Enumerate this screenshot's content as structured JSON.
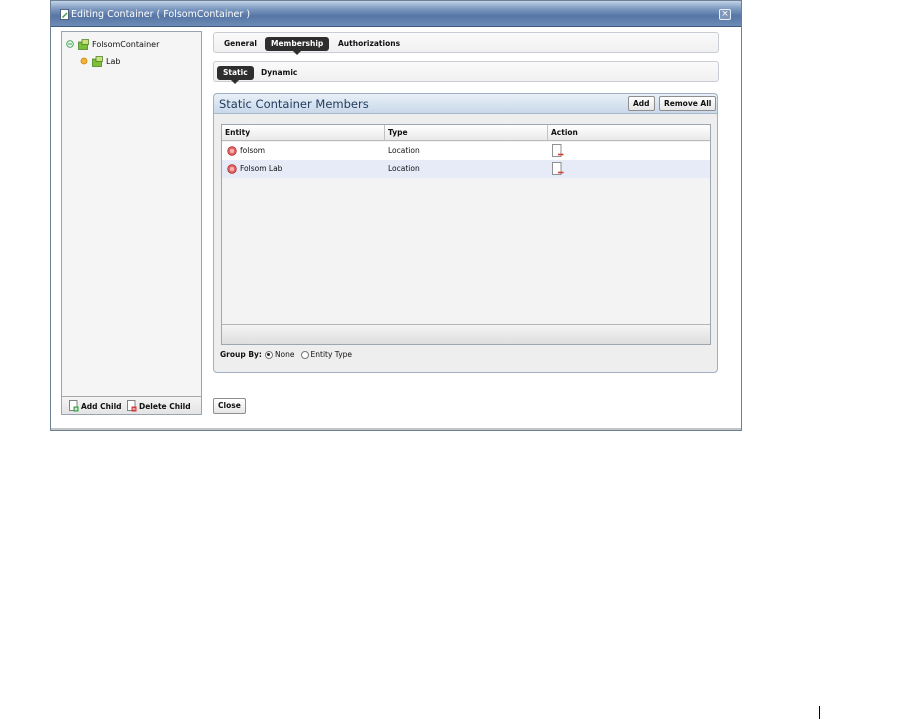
{
  "dialog": {
    "title": "Editing Container ( FolsomContainer )",
    "close_label": "×"
  },
  "tree": {
    "root": {
      "label": "FolsomContainer",
      "expanded": true,
      "toggle_icon": "minus-circle-icon",
      "icon": "container-icon"
    },
    "children": [
      {
        "label": "Lab",
        "toggle_icon": "leaf-dot-icon",
        "icon": "container-icon"
      }
    ],
    "footer": {
      "add_child_label": "Add Child",
      "delete_child_label": "Delete Child"
    }
  },
  "tabs": {
    "items": [
      {
        "label": "General",
        "active": false
      },
      {
        "label": "Membership",
        "active": true
      },
      {
        "label": "Authorizations",
        "active": false
      }
    ]
  },
  "subtabs": {
    "items": [
      {
        "label": "Static",
        "active": true
      },
      {
        "label": "Dynamic",
        "active": false
      }
    ]
  },
  "members_panel": {
    "title": "Static Container Members",
    "add_label": "Add",
    "remove_all_label": "Remove All",
    "columns": [
      "Entity",
      "Type",
      "Action"
    ],
    "rows": [
      {
        "entity": "folsom",
        "type": "Location",
        "status_icon": "red-status-icon",
        "action_icon": "remove-document-icon"
      },
      {
        "entity": "Folsom Lab",
        "type": "Location",
        "status_icon": "red-status-icon",
        "action_icon": "remove-document-icon"
      }
    ],
    "group_by": {
      "label": "Group By:",
      "options": [
        {
          "label": "None",
          "selected": true
        },
        {
          "label": "Entity Type",
          "selected": false
        }
      ]
    }
  },
  "footer": {
    "close_label": "Close"
  },
  "colors": {
    "titlebar": "#5676a5",
    "panel_header_text": "#1f3a5c",
    "selected_row": "#e7ebf8",
    "active_tab": "#2e2e2e",
    "status_red": "#d23a3a"
  }
}
